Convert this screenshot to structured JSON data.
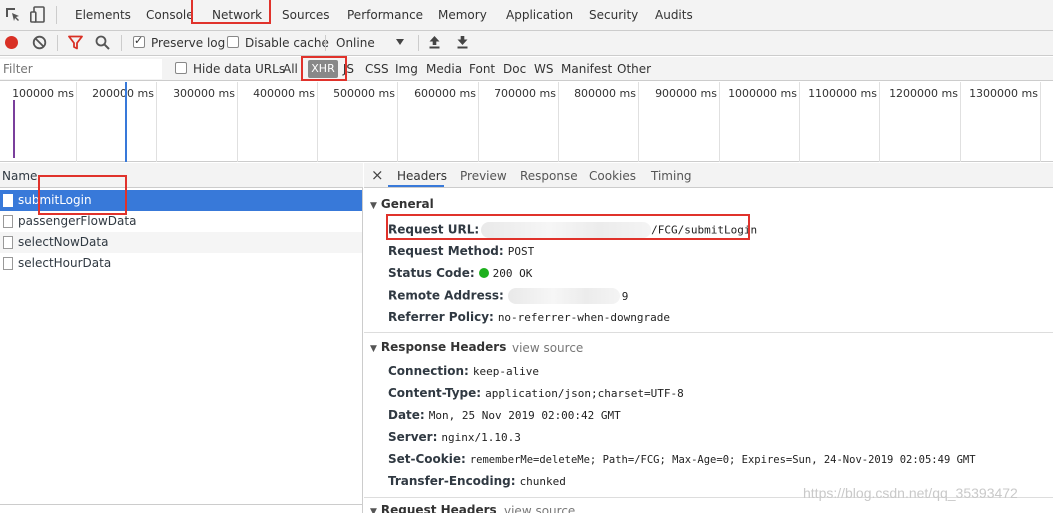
{
  "tabs": [
    "Elements",
    "Console",
    "Network",
    "Sources",
    "Performance",
    "Memory",
    "Application",
    "Security",
    "Audits"
  ],
  "toolbar": {
    "preserve_log": "Preserve log",
    "disable_cache": "Disable cache",
    "throttle": "Online"
  },
  "filterbar": {
    "placeholder": "Filter",
    "hide_data_urls": "Hide data URLs",
    "types": [
      "All",
      "XHR",
      "JS",
      "CSS",
      "Img",
      "Media",
      "Font",
      "Doc",
      "WS",
      "Manifest",
      "Other"
    ]
  },
  "timeline": {
    "ticks": [
      "100000 ms",
      "200000 ms",
      "300000 ms",
      "400000 ms",
      "500000 ms",
      "600000 ms",
      "700000 ms",
      "800000 ms",
      "900000 ms",
      "1000000 ms",
      "1100000 ms",
      "1200000 ms",
      "1300000 ms"
    ]
  },
  "requests": {
    "header": "Name",
    "items": [
      "submitLogin",
      "passengerFlowData",
      "selectNowData",
      "selectHourData"
    ]
  },
  "details": {
    "close": "×",
    "tabs": [
      "Headers",
      "Preview",
      "Response",
      "Cookies",
      "Timing"
    ],
    "general": {
      "title": "General",
      "request_url_label": "Request URL:",
      "request_url_value": "/FCG/submitLogin",
      "method_label": "Request Method:",
      "method_value": "POST",
      "status_label": "Status Code:",
      "status_value": "200 OK",
      "remote_label": "Remote Address:",
      "remote_value": "9",
      "referrer_label": "Referrer Policy:",
      "referrer_value": "no-referrer-when-downgrade"
    },
    "response_headers": {
      "title": "Response Headers",
      "view_source": "view source",
      "items": [
        {
          "k": "Connection:",
          "v": "keep-alive"
        },
        {
          "k": "Content-Type:",
          "v": "application/json;charset=UTF-8"
        },
        {
          "k": "Date:",
          "v": "Mon, 25 Nov 2019 02:00:42 GMT"
        },
        {
          "k": "Server:",
          "v": "nginx/1.10.3"
        },
        {
          "k": "Set-Cookie:",
          "v": "rememberMe=deleteMe; Path=/FCG; Max-Age=0; Expires=Sun, 24-Nov-2019 02:05:49 GMT"
        },
        {
          "k": "Transfer-Encoding:",
          "v": "chunked"
        }
      ]
    },
    "request_headers": {
      "title": "Request Headers",
      "view_source": "view source"
    }
  },
  "watermark": "https://blog.csdn.net/qq_35393472",
  "colors": {
    "accent": "#3879d9",
    "annotation": "#e0322b",
    "record": "#d93025",
    "status_ok": "#1db01d"
  }
}
